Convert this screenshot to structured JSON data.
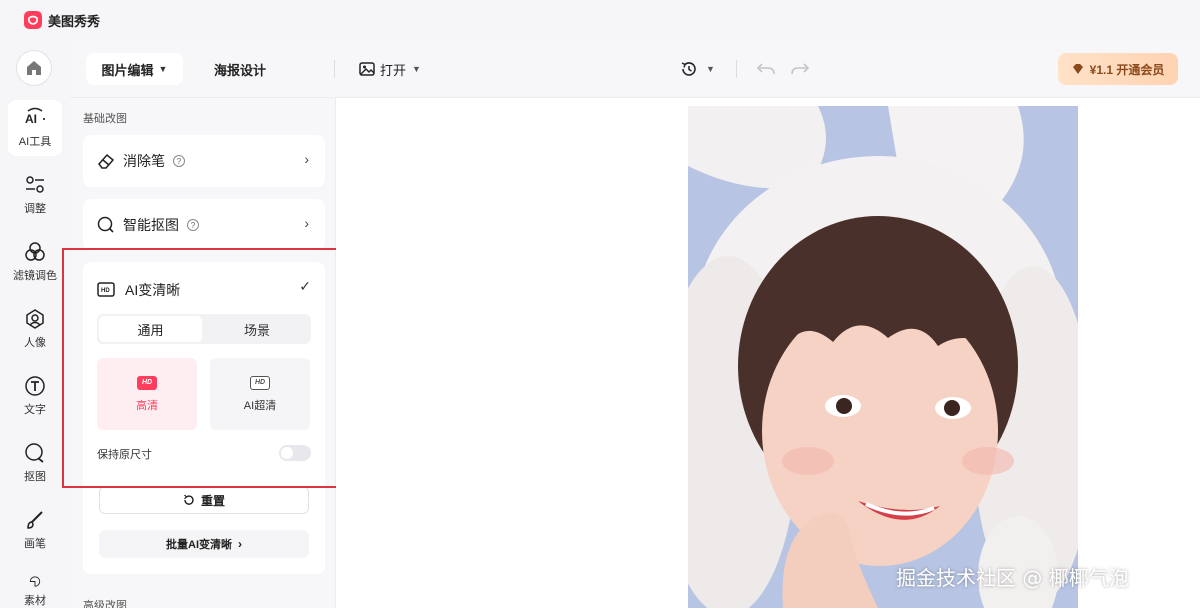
{
  "app": {
    "name": "美图秀秀",
    "logo_icon": "meitu-logo-icon",
    "brand_color": "#ff3d5c"
  },
  "rail": {
    "home_icon": "home-icon",
    "items": [
      {
        "label": "AI工具",
        "icon": "ai-icon",
        "active": true
      },
      {
        "label": "调整",
        "icon": "sliders-icon",
        "active": false
      },
      {
        "label": "滤镜调色",
        "icon": "filter-circles-icon",
        "active": false
      },
      {
        "label": "人像",
        "icon": "portrait-icon",
        "active": false
      },
      {
        "label": "文字",
        "icon": "text-icon",
        "active": false
      },
      {
        "label": "抠图",
        "icon": "cutout-icon",
        "active": false
      },
      {
        "label": "画笔",
        "icon": "brush-icon",
        "active": false
      },
      {
        "label": "素材",
        "icon": "sticker-icon",
        "active": false
      }
    ]
  },
  "toolbar": {
    "tab_edit": "图片编辑",
    "tab_poster": "海报设计",
    "open_label": "打开",
    "vip_label": "¥1.1 开通会员",
    "vip_color": "#8a4a1c"
  },
  "panel": {
    "section_basic": "基础改图",
    "section_advanced": "高级改图",
    "eraser_label": "消除笔",
    "cutout_label": "智能抠图",
    "ai": {
      "title": "AI变清晰",
      "check": "✓",
      "seg_general": "通用",
      "seg_scene": "场景",
      "mode_hd_badge": "HD",
      "mode_hd_label": "高清",
      "mode_ultra_badge": "HD",
      "mode_ultra_label": "AI超清",
      "keep_size_label": "保持原尺寸",
      "keep_size_on": false,
      "reset_label": "重置",
      "batch_label": "批量AI变清晰"
    }
  },
  "watermark": "掘金技术社区 @ 椰椰气泡"
}
